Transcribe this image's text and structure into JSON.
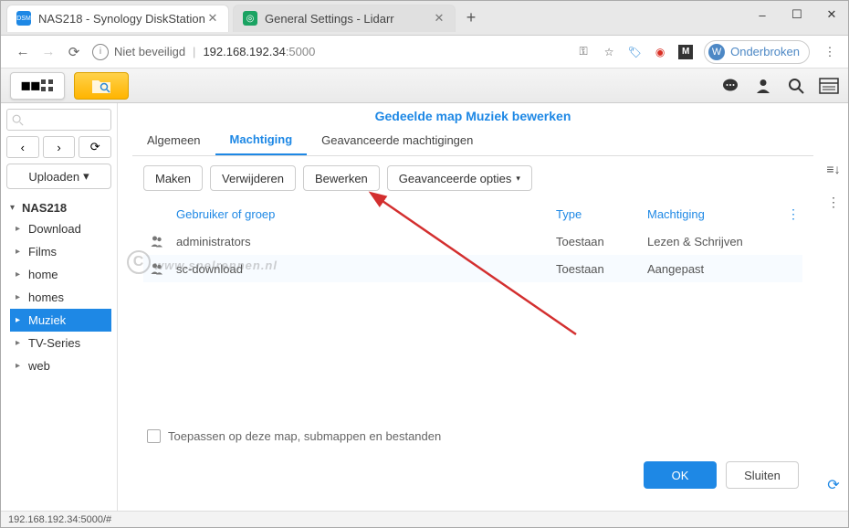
{
  "window_controls": {
    "min": "–",
    "max": "☐",
    "close": "✕"
  },
  "browser": {
    "tabs": [
      {
        "title": "NAS218 - Synology DiskStation",
        "favicon_bg": "#1e88e5",
        "favicon_text": "DSM",
        "favicon_color": "#fff",
        "active": true
      },
      {
        "title": "General Settings - Lidarr",
        "favicon_bg": "#1aa362",
        "favicon_text": "◎",
        "favicon_color": "#fff",
        "active": false
      }
    ],
    "newtab": "+"
  },
  "urlbar": {
    "back": "←",
    "forward": "→",
    "reload": "⟳",
    "security_icon": "i",
    "security_text": "Niet beveiligd",
    "host": "192.168.192.34",
    "port": ":5000",
    "icons": {
      "key": "⚿",
      "star": "☆",
      "label": "🏷",
      "block": "◉",
      "m": "M"
    },
    "profile_initial": "W",
    "profile_label": "Onderbroken",
    "menu": "⋮"
  },
  "dsm_toolbar": {
    "apps": "▦",
    "search_glass": "🔍",
    "right": {
      "chat": "💬",
      "user": "👤",
      "search": "🔍",
      "widget": "☰"
    }
  },
  "sidebar": {
    "search_placeholder": "",
    "nav": {
      "back": "‹",
      "fwd": "›",
      "refresh": "⟳"
    },
    "upload_label": "Uploaden",
    "upload_caret": "▾",
    "root_caret": "▾",
    "root_label": "NAS218",
    "items": [
      {
        "caret": "▸",
        "label": "Download",
        "selected": false
      },
      {
        "caret": "▸",
        "label": "Films",
        "selected": false
      },
      {
        "caret": "▸",
        "label": "home",
        "selected": false
      },
      {
        "caret": "▸",
        "label": "homes",
        "selected": false
      },
      {
        "caret": "▸",
        "label": "Muziek",
        "selected": true
      },
      {
        "caret": "▸",
        "label": "TV-Series",
        "selected": false
      },
      {
        "caret": "▸",
        "label": "web",
        "selected": false
      }
    ]
  },
  "dialog": {
    "title": "Gedeelde map Muziek bewerken",
    "tabs": [
      {
        "label": "Algemeen",
        "active": false
      },
      {
        "label": "Machtiging",
        "active": true
      },
      {
        "label": "Geavanceerde machtigingen",
        "active": false
      }
    ],
    "toolbar": {
      "create": "Maken",
      "delete": "Verwijderen",
      "edit": "Bewerken",
      "advanced": "Geavanceerde opties",
      "advanced_caret": "▾"
    },
    "headers": {
      "user": "Gebruiker of groep",
      "type": "Type",
      "perm": "Machtiging",
      "dots": "⋮"
    },
    "rows": [
      {
        "user": "administrators",
        "type": "Toestaan",
        "perm": "Lezen & Schrijven"
      },
      {
        "user": "sc-download",
        "type": "Toestaan",
        "perm": "Aangepast"
      }
    ],
    "apply_label": "Toepassen op deze map, submappen en bestanden",
    "ok": "OK",
    "close": "Sluiten"
  },
  "right_strip": {
    "sort": "≡↓",
    "cols": "⋮",
    "refresh": "⟳"
  },
  "statusbar": {
    "text": "192.168.192.34:5000/#"
  },
  "watermark": "www.snelrennen.nl"
}
